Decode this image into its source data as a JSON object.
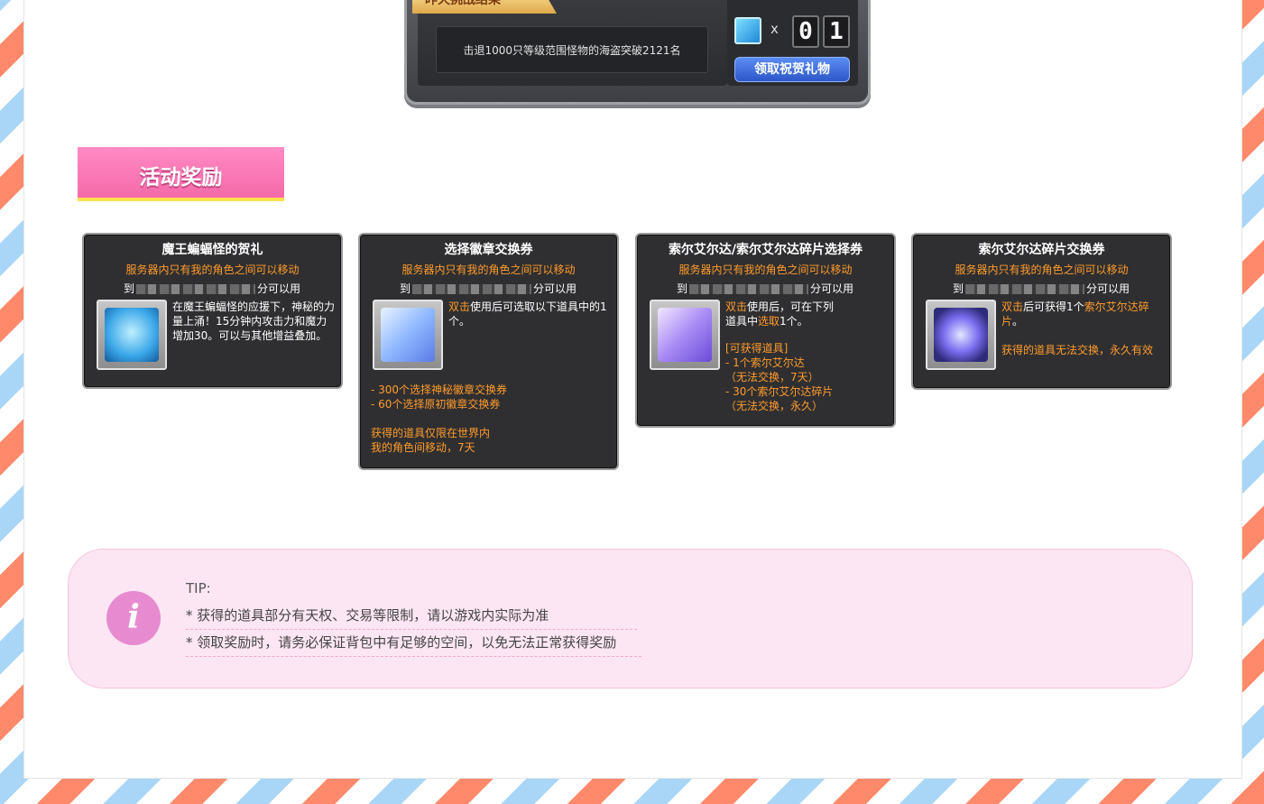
{
  "result": {
    "banner": "昨天挑战结果",
    "description": "击退1000只等级范围怪物的海盗突破2121名",
    "multiplier": "x",
    "digits": [
      "0",
      "1"
    ],
    "claim_button": "领取祝贺礼物"
  },
  "section_heading": "活动奖励",
  "cards": [
    {
      "title": "魔王蝙蝠怪的贺礼",
      "restriction": "服务器内只有我的角色之间可以移动",
      "date_prefix": "到",
      "date_suffix": "分可以用",
      "description": "在魔王蝙蝠怪的应援下，神秘的力量上涌！15分钟内攻击力和魔力增加30。可以与其他增益叠加。",
      "colors": {
        "art": "#3aa6e8"
      }
    },
    {
      "title": "选择徽章交换券",
      "restriction": "服务器内只有我的角色之间可以移动",
      "date_prefix": "到",
      "date_suffix": "分可以用",
      "desc_highlight": "双击",
      "description": "使用后可选取以下道具中的1个。",
      "list": [
        "- 300个选择神秘徽章交换券",
        "- 60个选择原初徽章交换券"
      ],
      "note": [
        "获得的道具仅限在世界内",
        "我的角色间移动，7天"
      ]
    },
    {
      "title": "索尔艾尔达/索尔艾尔达碎片选择券",
      "restriction": "服务器内只有我的角色之间可以移动",
      "date_prefix": "到",
      "date_suffix": "分可以用",
      "desc_highlight": "双击",
      "description_a": "使用后，可在下列",
      "description_b": "道具中",
      "desc_highlight_2": "选取",
      "description_c": "1个。",
      "list_title": "[可获得道具]",
      "list": [
        "- 1个索尔艾尔达",
        "（无法交换，7天）",
        "- 30个索尔艾尔达碎片",
        "（无法交换，永久）"
      ]
    },
    {
      "title": "索尔艾尔达碎片交换券",
      "restriction": "服务器内只有我的角色之间可以移动",
      "date_prefix": "到",
      "date_suffix": "分可以用",
      "desc_highlight": "双击",
      "description": "后可获得1个",
      "desc_highlight_2": "索尔艾尔达碎片",
      "description_end": "。",
      "note": "获得的道具无法交换，永久有效"
    }
  ],
  "tip": {
    "label": "TIP:",
    "lines": [
      "* 获得的道具部分有天权、交易等限制，请以游戏内实际为准",
      "* 领取奖励时，请务必保证背包中有足够的空间，以免无法正常获得奖励"
    ]
  }
}
